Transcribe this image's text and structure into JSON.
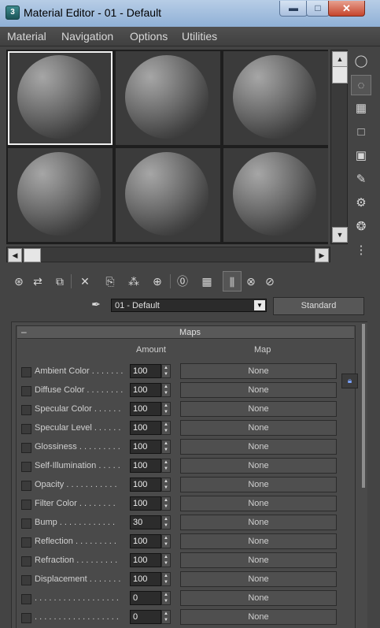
{
  "window": {
    "title": "Material Editor - 01 - Default",
    "app_icon": "3ds-max-icon",
    "minimize_glyph": "▬",
    "maximize_glyph": "□",
    "close_glyph": "✕"
  },
  "menu": [
    "Material",
    "Navigation",
    "Options",
    "Utilities"
  ],
  "material_slots": {
    "count": 6,
    "active_index": 0
  },
  "material": {
    "name": "01 - Default",
    "type": "Standard"
  },
  "maps_rollout": {
    "title": "Maps",
    "collapse_glyph": "–",
    "amount_header": "Amount",
    "map_header": "Map",
    "rows": [
      {
        "label": "Ambient Color . . . . . . .",
        "amount": "100",
        "map": "None"
      },
      {
        "label": "Diffuse Color . . . . . . . .",
        "amount": "100",
        "map": "None"
      },
      {
        "label": "Specular Color . . . . . .",
        "amount": "100",
        "map": "None"
      },
      {
        "label": "Specular Level . . . . . .",
        "amount": "100",
        "map": "None"
      },
      {
        "label": "Glossiness . . . . . . . . .",
        "amount": "100",
        "map": "None"
      },
      {
        "label": "Self-Illumination . . . . .",
        "amount": "100",
        "map": "None"
      },
      {
        "label": "Opacity . . . . . . . . . . .",
        "amount": "100",
        "map": "None"
      },
      {
        "label": "Filter Color . . . . . . . .",
        "amount": "100",
        "map": "None"
      },
      {
        "label": "Bump . . . . . . . . . . . .",
        "amount": "30",
        "map": "None"
      },
      {
        "label": "Reflection . . . . . . . . .",
        "amount": "100",
        "map": "None"
      },
      {
        "label": "Refraction . . . . . . . . .",
        "amount": "100",
        "map": "None"
      },
      {
        "label": "Displacement . . . . . . .",
        "amount": "100",
        "map": "None"
      },
      {
        "label": ". . . . . . . . . . . . . . . . . .",
        "amount": "0",
        "map": "None"
      },
      {
        "label": ". . . . . . . . . . . . . . . . . .",
        "amount": "0",
        "map": "None"
      }
    ]
  },
  "toolbar_icons": {
    "side": [
      {
        "name": "sample-type-sphere-icon",
        "glyph": "◯"
      },
      {
        "name": "backlight-icon",
        "glyph": "◌"
      },
      {
        "name": "background-checker-icon",
        "glyph": "▦"
      },
      {
        "name": "sample-uv-tiling-icon",
        "glyph": "□"
      },
      {
        "name": "video-color-check-icon",
        "glyph": "▣"
      },
      {
        "name": "make-preview-icon",
        "glyph": "✎"
      },
      {
        "name": "material-options-icon",
        "glyph": "⚙"
      },
      {
        "name": "select-by-material-icon",
        "glyph": "❂"
      },
      {
        "name": "material-map-navigator-icon",
        "glyph": "⋮"
      }
    ],
    "bottom": [
      {
        "name": "get-material-icon",
        "glyph": "⊛"
      },
      {
        "name": "put-material-to-scene-icon",
        "glyph": "⇄"
      },
      {
        "name": "assign-material-to-selection-icon",
        "glyph": "⧉"
      },
      {
        "name": "reset-map-icon",
        "glyph": "✕"
      },
      {
        "name": "make-material-copy-icon",
        "glyph": "⎘"
      },
      {
        "name": "make-unique-icon",
        "glyph": "⁂"
      },
      {
        "name": "put-to-library-icon",
        "glyph": "⊕"
      },
      {
        "name": "material-id-channel-icon",
        "glyph": "⓪"
      },
      {
        "name": "show-map-in-viewport-icon",
        "glyph": "▦"
      },
      {
        "name": "show-end-result-icon",
        "glyph": "⫼"
      },
      {
        "name": "go-to-parent-icon",
        "glyph": "⊗"
      },
      {
        "name": "go-forward-to-sibling-icon",
        "glyph": "⊘"
      }
    ],
    "eyedropper": "✒",
    "lock": "🔒︎"
  }
}
